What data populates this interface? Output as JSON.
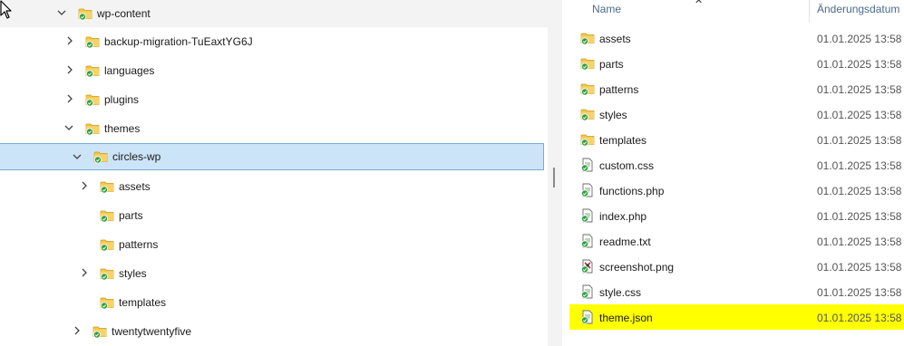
{
  "tree": {
    "items": [
      {
        "label": "wp-content",
        "chevron": "down"
      },
      {
        "label": "backup-migration-TuEaxtYG6J",
        "chevron": "right"
      },
      {
        "label": "languages",
        "chevron": "right"
      },
      {
        "label": "plugins",
        "chevron": "right"
      },
      {
        "label": "themes",
        "chevron": "down"
      },
      {
        "label": "circles-wp",
        "chevron": "down",
        "selected": true
      },
      {
        "label": "assets",
        "chevron": "right"
      },
      {
        "label": "parts",
        "chevron": "none"
      },
      {
        "label": "patterns",
        "chevron": "none"
      },
      {
        "label": "styles",
        "chevron": "right"
      },
      {
        "label": "templates",
        "chevron": "none"
      },
      {
        "label": "twentytwentyfive",
        "chevron": "right"
      }
    ]
  },
  "list": {
    "columns": {
      "name": "Name",
      "date": "Änderungsdatum"
    },
    "rows": [
      {
        "name": "assets",
        "date": "01.01.2025 13:58",
        "icon": "folder-synced-icon"
      },
      {
        "name": "parts",
        "date": "01.01.2025 13:58",
        "icon": "folder-synced-icon"
      },
      {
        "name": "patterns",
        "date": "01.01.2025 13:58",
        "icon": "folder-synced-icon"
      },
      {
        "name": "styles",
        "date": "01.01.2025 13:58",
        "icon": "folder-synced-icon"
      },
      {
        "name": "templates",
        "date": "01.01.2025 13:58",
        "icon": "folder-synced-icon"
      },
      {
        "name": "custom.css",
        "date": "01.01.2025 13:58",
        "icon": "file-synced-icon"
      },
      {
        "name": "functions.php",
        "date": "01.01.2025 13:58",
        "icon": "file-synced-icon"
      },
      {
        "name": "index.php",
        "date": "01.01.2025 13:58",
        "icon": "file-synced-icon"
      },
      {
        "name": "readme.txt",
        "date": "01.01.2025 13:58",
        "icon": "file-synced-icon"
      },
      {
        "name": "screenshot.png",
        "date": "01.01.2025 13:58",
        "icon": "image-file-synced-icon"
      },
      {
        "name": "style.css",
        "date": "01.01.2025 13:58",
        "icon": "file-synced-icon"
      },
      {
        "name": "theme.json",
        "date": "01.01.2025 13:58",
        "icon": "file-synced-icon",
        "highlighted": true
      }
    ]
  },
  "colors": {
    "selection": "#cce4f7",
    "selection_border": "#7aa9d6",
    "highlight": "#ffff00",
    "folder": "#f5c542",
    "sync_badge": "#2e9e3e"
  }
}
